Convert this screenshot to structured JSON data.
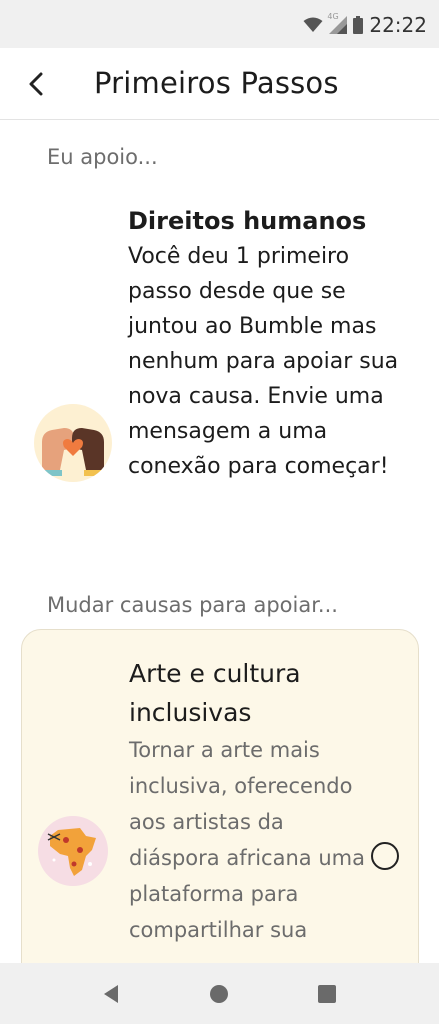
{
  "status_bar": {
    "time": "22:22",
    "network_label": "4G",
    "icons": [
      "wifi-icon",
      "signal-icon",
      "battery-icon"
    ]
  },
  "header": {
    "title": "Primeiros Passos",
    "back_icon": "chevron-left-icon"
  },
  "current_section": {
    "label": "Eu apoio...",
    "cause": {
      "title": "Direitos humanos",
      "description": "Você deu 1 primeiro passo desde que se juntou ao Bumble mas nenhum para apoiar sua nova causa. Envie uma mensagem a uma conexão para começar!",
      "icon": "heart-hands-icon"
    }
  },
  "change_section": {
    "label": "Mudar causas para apoiar...",
    "options": [
      {
        "title": "Arte e cultura inclusivas",
        "description": "Tornar a arte mais inclusiva, oferecendo aos artistas da diáspora africana uma plataforma para compartilhar sua",
        "icon": "africa-map-icon",
        "selected": false
      }
    ]
  },
  "nav_bar": {
    "icons": [
      "nav-back-icon",
      "nav-home-icon",
      "nav-recents-icon"
    ]
  },
  "colors": {
    "card_background": "#fdf8e8",
    "card_border": "#e6dfcb",
    "secondary_text": "#6c6c6c",
    "system_bar": "#f0f0f0",
    "heart_orange": "#f07b3f",
    "africa_orange": "#f2a23a"
  }
}
